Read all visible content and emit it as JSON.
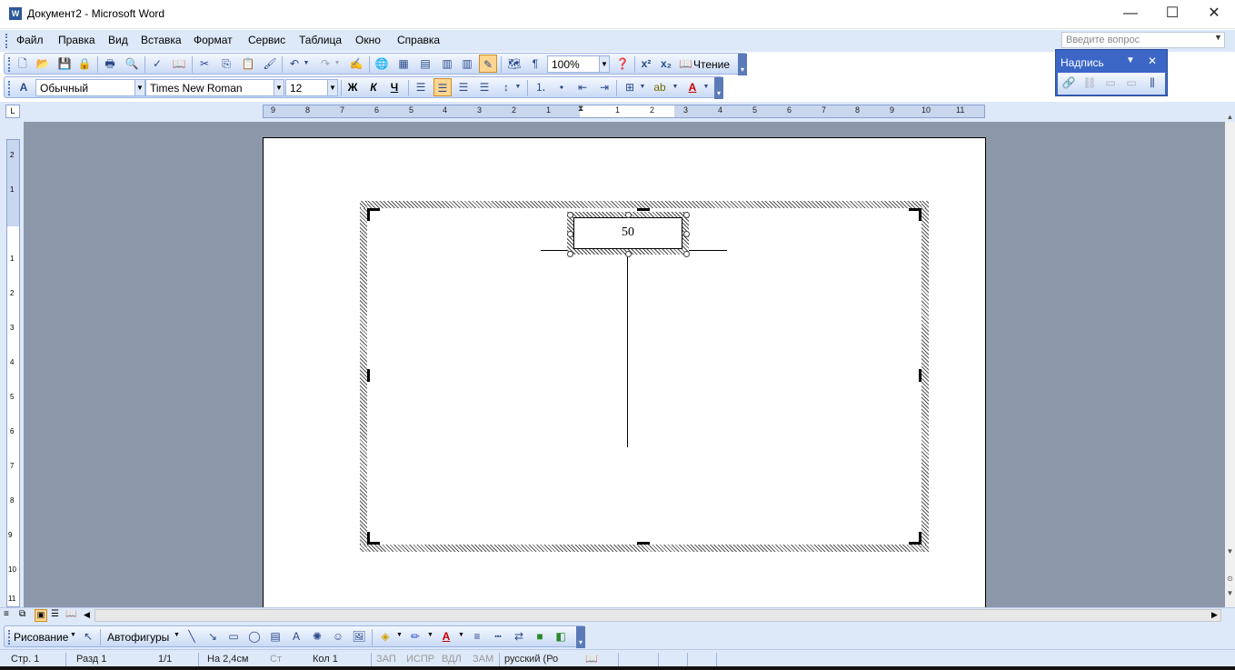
{
  "window": {
    "title": "Документ2 - Microsoft Word",
    "app_icon": "word-icon",
    "minimize": "—",
    "maximize": "☐",
    "close": "✕"
  },
  "menu": {
    "items": [
      "Файл",
      "Правка",
      "Вид",
      "Вставка",
      "Формат",
      "Сервис",
      "Таблица",
      "Окно",
      "Справка"
    ],
    "ask_placeholder": "Введите вопрос"
  },
  "standard_toolbar": {
    "zoom": "100%",
    "superscript": "x²",
    "subscript": "x₂",
    "reading": "Чтение",
    "pilcrow": "¶"
  },
  "formatting_toolbar": {
    "style": "Обычный",
    "font": "Times New Roman",
    "size": "12",
    "bold": "Ж",
    "italic": "К",
    "underline": "Ч"
  },
  "textbox_toolbar": {
    "title": "Надпись"
  },
  "ruler": {
    "left_labels": [
      "9",
      "8",
      "7",
      "6",
      "5",
      "4",
      "3",
      "2",
      "1"
    ],
    "right_labels": [
      "1",
      "2",
      "3",
      "4",
      "5",
      "6",
      "7",
      "8",
      "9",
      "10",
      "11"
    ],
    "vertical_labels": [
      "2",
      "1",
      "1",
      "2",
      "3",
      "4",
      "5",
      "6",
      "7",
      "8",
      "9",
      "10",
      "11"
    ],
    "corner": "L"
  },
  "document": {
    "textbox_value": "50"
  },
  "drawing_toolbar": {
    "draw_menu": "Рисование",
    "autoshapes": "Автофигуры"
  },
  "statusbar": {
    "page": "Стр. 1",
    "section": "Разд 1",
    "pages": "1/1",
    "position": "На 2,4см",
    "line": "Ст",
    "column": "Кол 1",
    "rec": "ЗАП",
    "trk": "ИСПР",
    "ext": "ВДЛ",
    "ovr": "ЗАМ",
    "language": "русский (Ро"
  },
  "colors": {
    "toolbar_bg": "#dde8f8",
    "doc_bg": "#8c97a9",
    "float_title": "#3b66c6",
    "pressed": "#ffd58f"
  }
}
